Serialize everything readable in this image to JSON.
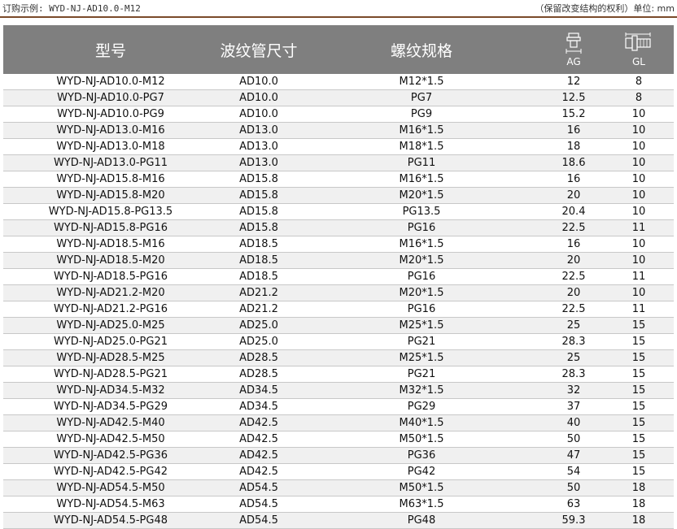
{
  "top": {
    "left": "订购示例: WYD-NJ-AD10.0-M12",
    "right": "（保留改变结构的权利）单位: mm"
  },
  "header": {
    "model": "型号",
    "hose": "波纹管尺寸",
    "thread": "螺纹规格",
    "ag": "AG",
    "gl": "GL"
  },
  "icons": {
    "ag": "fitting-ag-icon",
    "gl": "fitting-gl-icon"
  },
  "colors": {
    "header_bg": "#7f7f7f",
    "accent_line": "#7a4a2a",
    "stripe": "#f0f0f0"
  },
  "rows": [
    [
      "WYD-NJ-AD10.0-M12",
      "AD10.0",
      "M12*1.5",
      "12",
      "8"
    ],
    [
      "WYD-NJ-AD10.0-PG7",
      "AD10.0",
      "PG7",
      "12.5",
      "8"
    ],
    [
      "WYD-NJ-AD10.0-PG9",
      "AD10.0",
      "PG9",
      "15.2",
      "10"
    ],
    [
      "WYD-NJ-AD13.0-M16",
      "AD13.0",
      "M16*1.5",
      "16",
      "10"
    ],
    [
      "WYD-NJ-AD13.0-M18",
      "AD13.0",
      "M18*1.5",
      "18",
      "10"
    ],
    [
      "WYD-NJ-AD13.0-PG11",
      "AD13.0",
      "PG11",
      "18.6",
      "10"
    ],
    [
      "WYD-NJ-AD15.8-M16",
      "AD15.8",
      "M16*1.5",
      "16",
      "10"
    ],
    [
      "WYD-NJ-AD15.8-M20",
      "AD15.8",
      "M20*1.5",
      "20",
      "10"
    ],
    [
      "WYD-NJ-AD15.8-PG13.5",
      "AD15.8",
      "PG13.5",
      "20.4",
      "10"
    ],
    [
      "WYD-NJ-AD15.8-PG16",
      "AD15.8",
      "PG16",
      "22.5",
      "11"
    ],
    [
      "WYD-NJ-AD18.5-M16",
      "AD18.5",
      "M16*1.5",
      "16",
      "10"
    ],
    [
      "WYD-NJ-AD18.5-M20",
      "AD18.5",
      "M20*1.5",
      "20",
      "10"
    ],
    [
      "WYD-NJ-AD18.5-PG16",
      "AD18.5",
      "PG16",
      "22.5",
      "11"
    ],
    [
      "WYD-NJ-AD21.2-M20",
      "AD21.2",
      "M20*1.5",
      "20",
      "10"
    ],
    [
      "WYD-NJ-AD21.2-PG16",
      "AD21.2",
      "PG16",
      "22.5",
      "11"
    ],
    [
      "WYD-NJ-AD25.0-M25",
      "AD25.0",
      "M25*1.5",
      "25",
      "15"
    ],
    [
      "WYD-NJ-AD25.0-PG21",
      "AD25.0",
      "PG21",
      "28.3",
      "15"
    ],
    [
      "WYD-NJ-AD28.5-M25",
      "AD28.5",
      "M25*1.5",
      "25",
      "15"
    ],
    [
      "WYD-NJ-AD28.5-PG21",
      "AD28.5",
      "PG21",
      "28.3",
      "15"
    ],
    [
      "WYD-NJ-AD34.5-M32",
      "AD34.5",
      "M32*1.5",
      "32",
      "15"
    ],
    [
      "WYD-NJ-AD34.5-PG29",
      "AD34.5",
      "PG29",
      "37",
      "15"
    ],
    [
      "WYD-NJ-AD42.5-M40",
      "AD42.5",
      "M40*1.5",
      "40",
      "15"
    ],
    [
      "WYD-NJ-AD42.5-M50",
      "AD42.5",
      "M50*1.5",
      "50",
      "15"
    ],
    [
      "WYD-NJ-AD42.5-PG36",
      "AD42.5",
      "PG36",
      "47",
      "15"
    ],
    [
      "WYD-NJ-AD42.5-PG42",
      "AD42.5",
      "PG42",
      "54",
      "15"
    ],
    [
      "WYD-NJ-AD54.5-M50",
      "AD54.5",
      "M50*1.5",
      "50",
      "18"
    ],
    [
      "WYD-NJ-AD54.5-M63",
      "AD54.5",
      "M63*1.5",
      "63",
      "18"
    ],
    [
      "WYD-NJ-AD54.5-PG48",
      "AD54.5",
      "PG48",
      "59.3",
      "18"
    ]
  ]
}
